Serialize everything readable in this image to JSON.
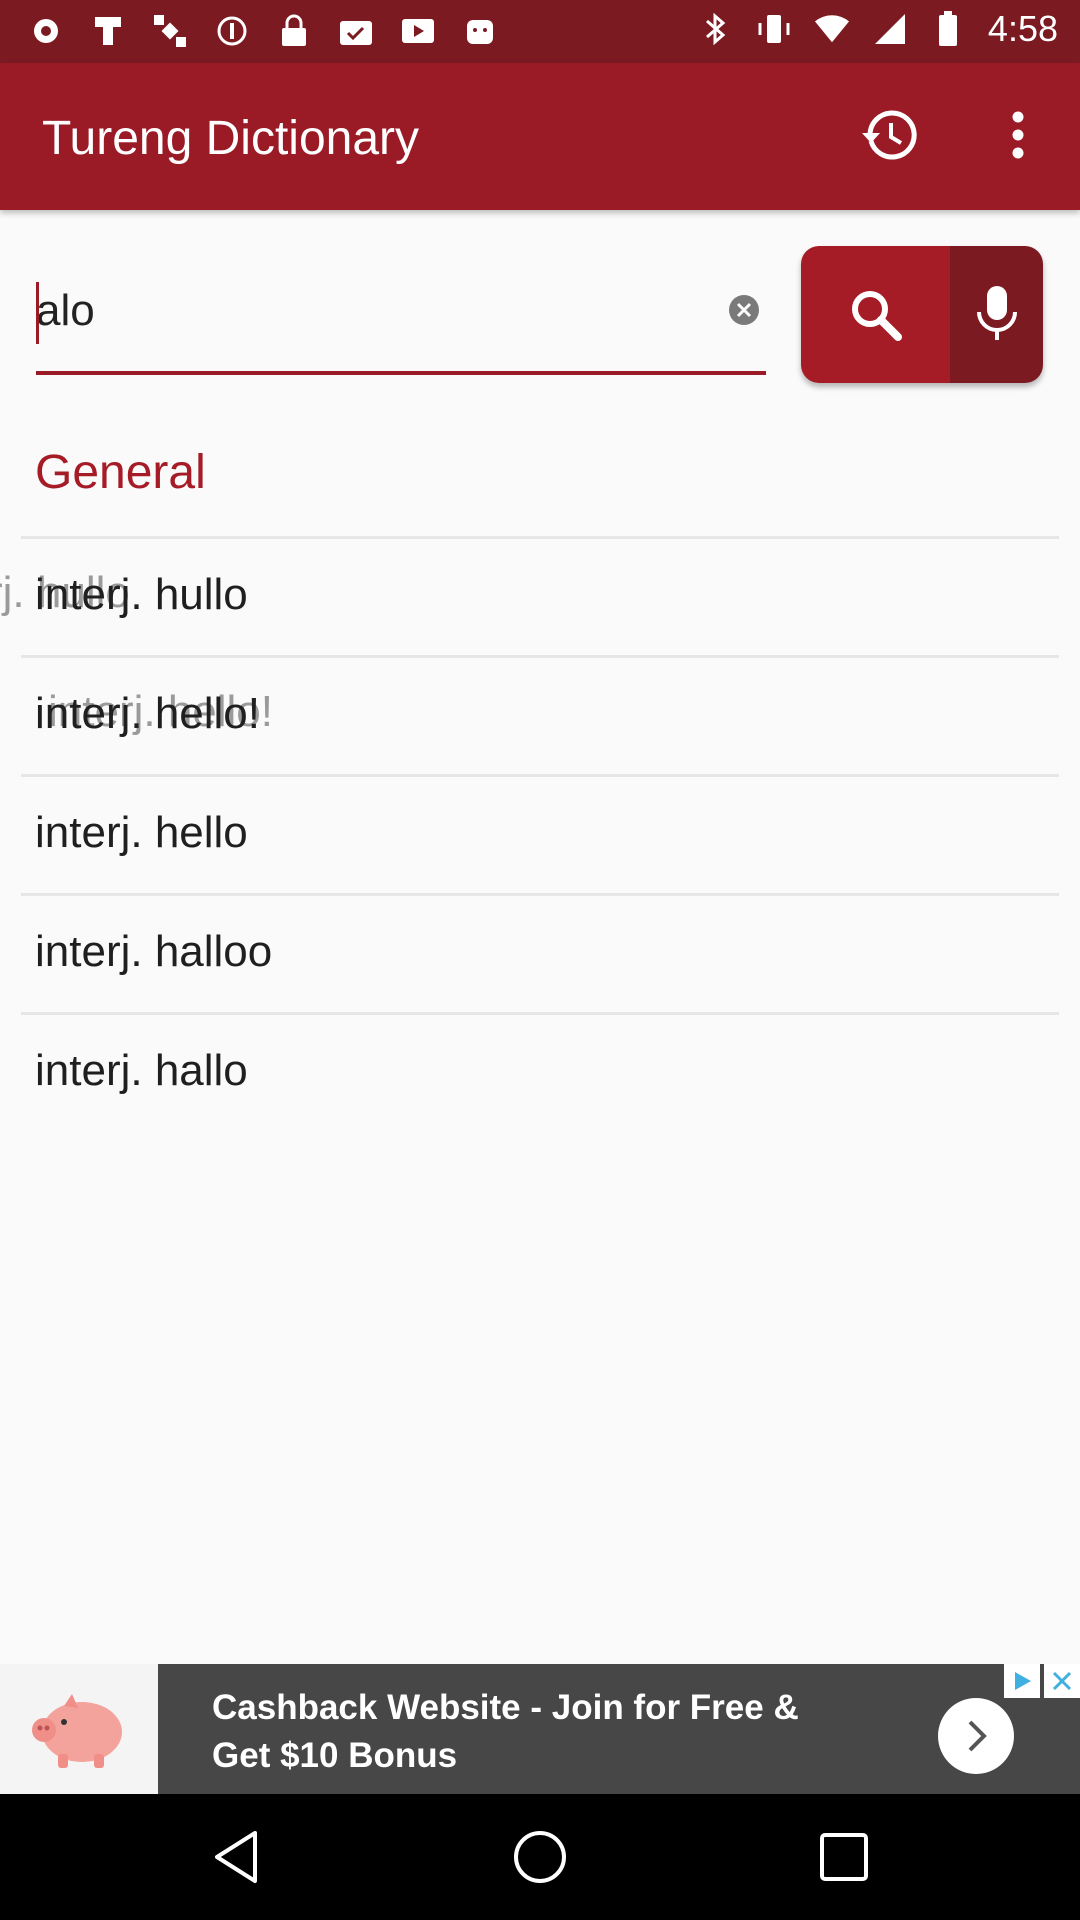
{
  "status_bar": {
    "time": "4:58",
    "left_icons": [
      "record-icon",
      "fake-gps-icon",
      "satellite-icon",
      "blocked-icon",
      "lock-icon",
      "task-icon",
      "video-icon",
      "android-icon"
    ],
    "right_icons": [
      "bluetooth-icon",
      "vibrate-icon",
      "wifi-icon",
      "signal-icon",
      "battery-icon"
    ]
  },
  "app_bar": {
    "title": "Tureng Dictionary",
    "actions": [
      "history-icon",
      "more-vert-icon"
    ]
  },
  "search": {
    "value": "alo",
    "placeholder": ""
  },
  "results": {
    "section_title": "General",
    "items": [
      {
        "text": "interj. hullo",
        "ghost": "rj. hullo"
      },
      {
        "text": "interj. hello!",
        "ghost": "interj. hello!"
      },
      {
        "text": "interj. hello"
      },
      {
        "text": "interj. halloo"
      },
      {
        "text": "interj. hallo"
      }
    ]
  },
  "ad": {
    "line1": "Cashback Website - Join for Free &",
    "line2": "Get $10 Bonus"
  },
  "colors": {
    "status_bar": "#7c1a22",
    "app_bar": "#9a1b26",
    "accent": "#a51c27",
    "mic": "#7c1a22"
  }
}
